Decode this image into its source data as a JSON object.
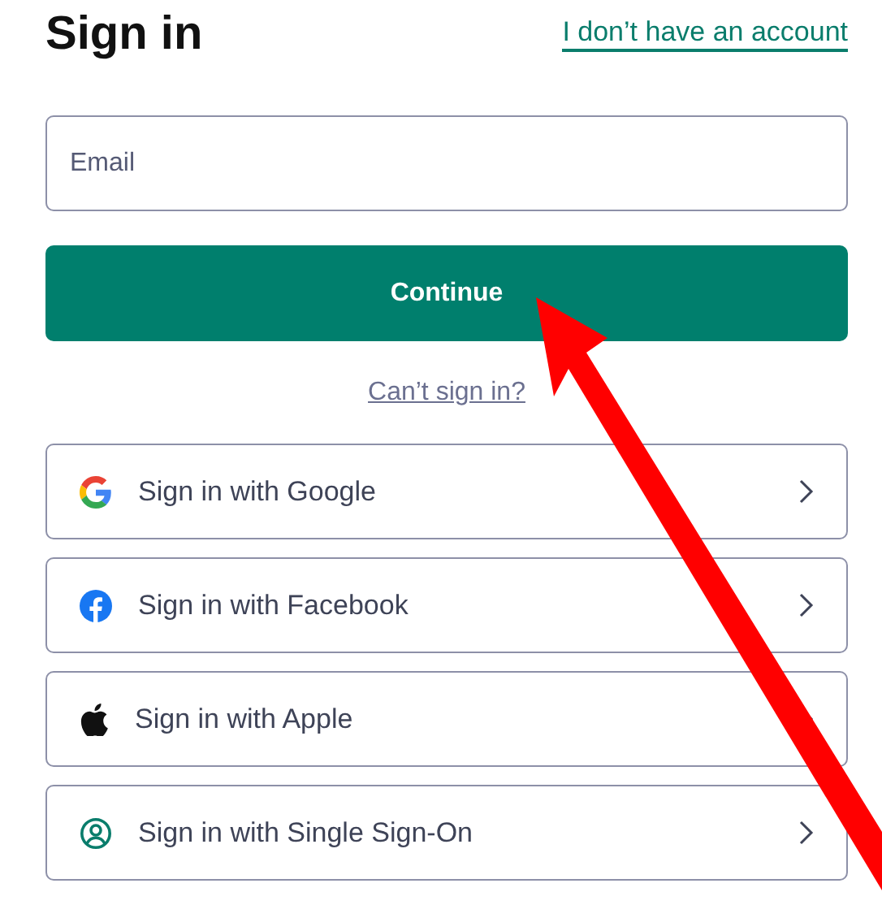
{
  "heading": "Sign in",
  "account_link": "I don’t have an account",
  "email": {
    "placeholder": "Email"
  },
  "continue_button": "Continue",
  "help_link": "Can’t sign in?",
  "options": [
    {
      "kind": "google",
      "label": "Sign in with Google"
    },
    {
      "kind": "facebook",
      "label": "Sign in with Facebook"
    },
    {
      "kind": "apple",
      "label": "Sign in with Apple"
    },
    {
      "kind": "sso",
      "label": "Sign in with Single Sign-On"
    }
  ],
  "annotations": [
    {
      "kind": "arrow"
    }
  ]
}
